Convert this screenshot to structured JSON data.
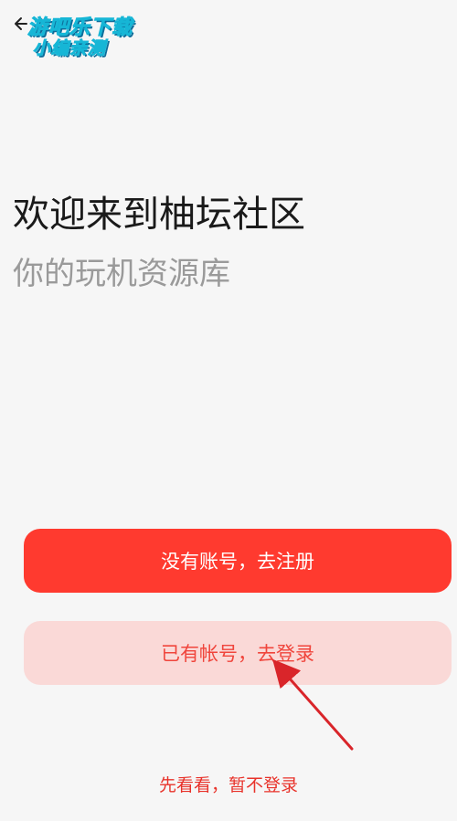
{
  "watermark": {
    "line1": "游吧乐下载",
    "line2": "小编亲测"
  },
  "header": {
    "back_icon": "back-arrow-icon"
  },
  "welcome": {
    "title": "欢迎来到柚坛社区",
    "subtitle": "你的玩机资源库"
  },
  "actions": {
    "register_label": "没有账号，去注册",
    "login_label": "已有帐号，去登录",
    "skip_label": "先看看，暂不登录"
  },
  "colors": {
    "primary": "#ff3a2f",
    "primary_light": "#fad9d7",
    "background": "#f6f6f6",
    "annotation": "#d9252a"
  }
}
